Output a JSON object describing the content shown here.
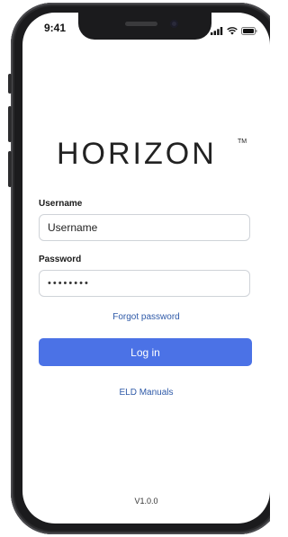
{
  "status_bar": {
    "time": "9:41"
  },
  "brand": {
    "logo_text": "HORIZON",
    "trademark": "TM"
  },
  "form": {
    "username_label": "Username",
    "username_placeholder": "Username",
    "password_label": "Password",
    "password_value": "••••••••",
    "forgot_password": "Forgot password",
    "login_button": "Log in",
    "eld_manuals": "ELD Manuals"
  },
  "footer": {
    "version": "V1.0.0"
  },
  "colors": {
    "primary": "#4b72e6",
    "link": "#2f5aa8",
    "frame": "#1b1b1d"
  },
  "icons": {
    "signal": "signal-icon",
    "wifi": "wifi-icon",
    "battery": "battery-icon"
  }
}
